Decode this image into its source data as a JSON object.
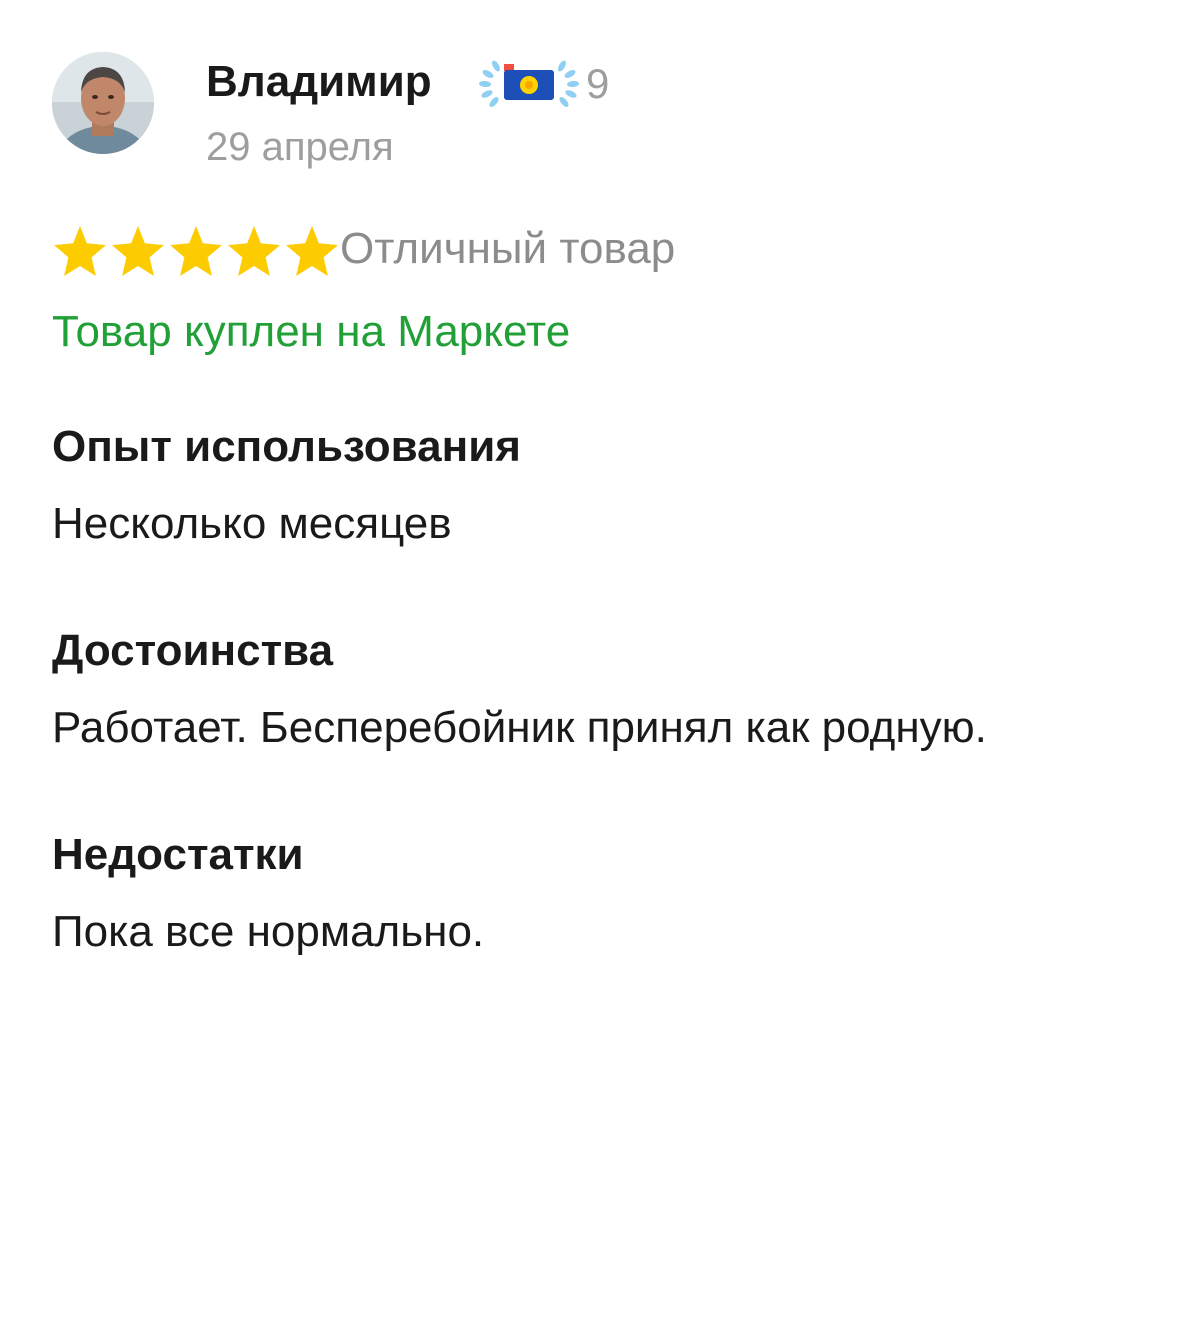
{
  "review": {
    "author": {
      "name": "Владимир",
      "badge_icon": "camera-laurel-badge-icon",
      "badge_count": "9",
      "avatar": "user-avatar"
    },
    "date": "29 апреля",
    "rating": {
      "value": 5,
      "max": 5,
      "star_color": "#fdcc00",
      "label": "Отличный товар"
    },
    "purchase_note": "Товар куплен на Маркете",
    "purchase_note_color": "#21a038",
    "sections": [
      {
        "title": "Опыт использования",
        "text": "Несколько месяцев"
      },
      {
        "title": "Достоинства",
        "text": "Работает. Бесперебойник принял как родную."
      },
      {
        "title": "Недостатки",
        "text": "Пока все нормально."
      }
    ]
  }
}
